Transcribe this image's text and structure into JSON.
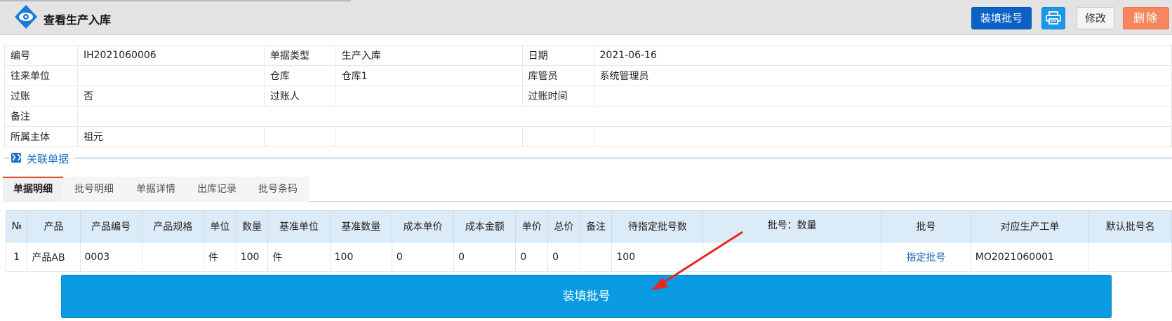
{
  "header": {
    "title": "查看生产入库",
    "fill_batch_label": "装填批号",
    "edit_label": "修改",
    "delete_label": "删除"
  },
  "info": {
    "rows": [
      [
        "编号",
        "IH2021060006",
        "单据类型",
        "生产入库",
        "日期",
        "2021-06-16"
      ],
      [
        "往来单位",
        "",
        "仓库",
        "仓库1",
        "库管员",
        "系统管理员"
      ],
      [
        "过账",
        "否",
        "过账人",
        "",
        "过账时间",
        ""
      ],
      [
        "备注",
        ""
      ],
      [
        "所属主体",
        "祖元",
        "",
        "",
        "",
        ""
      ]
    ]
  },
  "related": {
    "label": "关联单据"
  },
  "tabs": [
    "单据明细",
    "批号明细",
    "单据详情",
    "出库记录",
    "批号条码"
  ],
  "grid": {
    "headers": [
      "№",
      "产品",
      "产品编号",
      "产品规格",
      "单位",
      "数量",
      "基准单位",
      "基准数量",
      "成本单价",
      "成本金额",
      "单价",
      "总价",
      "备注",
      "待指定批号数",
      "批号：数量",
      "批号",
      "对应生产工单",
      "默认批号名"
    ],
    "rows": [
      [
        "1",
        "产品AB",
        "0003",
        "",
        "件",
        "100",
        "件",
        "100",
        "0",
        "0",
        "0",
        "0",
        "",
        "100",
        "",
        "指定批号",
        "MO2021060001",
        ""
      ]
    ]
  },
  "big_button": {
    "label": "装填批号"
  },
  "colors": {
    "primary": "#0b61c6",
    "accent_blue": "#0a9ae2",
    "delete": "#f5865d",
    "arrow": "#e8261d",
    "grid_header": "#dcebf8"
  },
  "icons": {
    "title": "eye-icon",
    "print": "printer-icon",
    "collapse": "double-chevron-down-icon"
  }
}
